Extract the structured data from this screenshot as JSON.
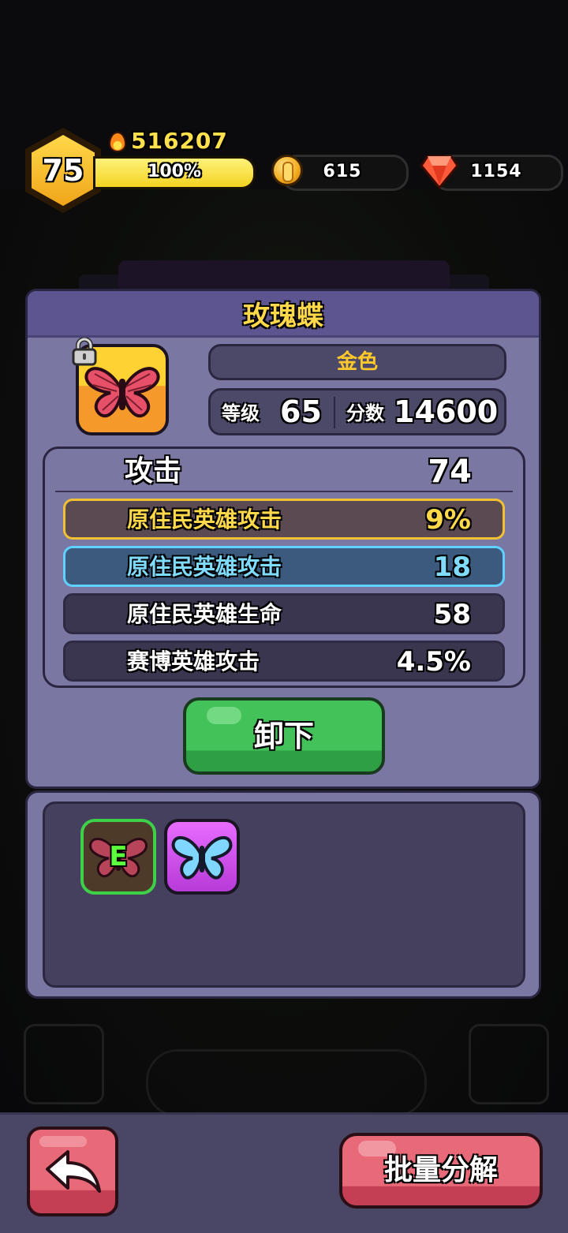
{
  "header": {
    "player_level": "75",
    "power": "516207",
    "xp_percent_label": "100%",
    "xp_fraction": 1.0,
    "coins": "615",
    "gems": "1154"
  },
  "item": {
    "name": "玫瑰蝶",
    "rarity": "金色",
    "level_label": "等级",
    "level": "65",
    "score_label": "分数",
    "score": "14600",
    "locked": true,
    "icon": "butterfly-icon"
  },
  "stats": {
    "main": {
      "label": "攻击",
      "value": "74"
    },
    "subs": [
      {
        "label": "原住民英雄攻击",
        "value": "9%",
        "tier": "gold"
      },
      {
        "label": "原住民英雄攻击",
        "value": "18",
        "tier": "blue"
      },
      {
        "label": "原住民英雄生命",
        "value": "58",
        "tier": "plain"
      },
      {
        "label": "赛博英雄攻击",
        "value": "4.5%",
        "tier": "plain"
      }
    ]
  },
  "actions": {
    "unequip_label": "卸下",
    "bulk_disassemble_label": "批量分解"
  },
  "inventory": {
    "items": [
      {
        "icon": "rose-butterfly-icon",
        "badge": "E",
        "equipped": true
      },
      {
        "icon": "blue-butterfly-icon",
        "badge": "",
        "equipped": false
      }
    ]
  },
  "colors": {
    "gold": "#ffd94a",
    "blue": "#7fdcff",
    "green_button": "#44c25a",
    "red_button": "#e86a78",
    "panel": "#7b77a3"
  }
}
